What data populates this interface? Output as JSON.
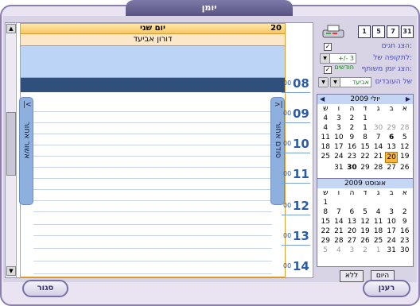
{
  "window": {
    "title": "יומן"
  },
  "day": {
    "number": "20",
    "name": "יום שני",
    "person": "דורון אביעד"
  },
  "side_tabs": {
    "left": "אשור אחור",
    "right": "סודם אחור"
  },
  "hours": [
    {
      "m": "00",
      "h": "08"
    },
    {
      "m": "00",
      "h": "09"
    },
    {
      "m": "00",
      "h": "10"
    },
    {
      "m": "00",
      "h": "11"
    },
    {
      "m": "00",
      "h": "12"
    },
    {
      "m": "00",
      "h": "13"
    },
    {
      "m": "00",
      "h": "14"
    }
  ],
  "toolbar": {
    "btn_31": "31",
    "btn_7": "7",
    "btn_5": "5",
    "btn_1": "1"
  },
  "options": {
    "show_holidays": "הצג חגים:",
    "period_label": "לתקופה של:",
    "period_value": "+/- 3 חודשים",
    "shared_label": "הצג יומן משותף:",
    "employees_label": "של העובדים",
    "employee_value": "אביעד"
  },
  "july": {
    "title": "יולי 2009",
    "dow": [
      "א",
      "ב",
      "ג",
      "ד",
      "ה",
      "ו",
      "ש"
    ],
    "rows": [
      [
        "",
        "",
        "",
        "1",
        "2",
        "3",
        "4"
      ],
      [
        "28",
        "29",
        "30",
        "1",
        "2",
        "3",
        "4"
      ],
      [
        "5",
        "6",
        "7",
        "8",
        "9",
        "10",
        "11"
      ],
      [
        "12",
        "13",
        "14",
        "15",
        "16",
        "17",
        "18"
      ],
      [
        "19",
        "20",
        "21",
        "22",
        "23",
        "24",
        "25"
      ],
      [
        "26",
        "27",
        "28",
        "29",
        "30",
        "31",
        ""
      ]
    ]
  },
  "august": {
    "title": "אוגוסט 2009",
    "rows": [
      [
        "",
        "",
        "",
        "",
        "",
        "",
        "1"
      ],
      [
        "2",
        "3",
        "4",
        "5",
        "6",
        "7",
        "8"
      ],
      [
        "9",
        "10",
        "11",
        "12",
        "13",
        "14",
        "15"
      ],
      [
        "16",
        "17",
        "18",
        "19",
        "20",
        "21",
        "22"
      ],
      [
        "23",
        "24",
        "25",
        "26",
        "27",
        "28",
        "29"
      ],
      [
        "30",
        "31",
        "1",
        "2",
        "3",
        "4",
        "5"
      ]
    ]
  },
  "buttons": {
    "today": "היום",
    "none": "ללא",
    "refresh": "רענן",
    "close": "סגור"
  }
}
